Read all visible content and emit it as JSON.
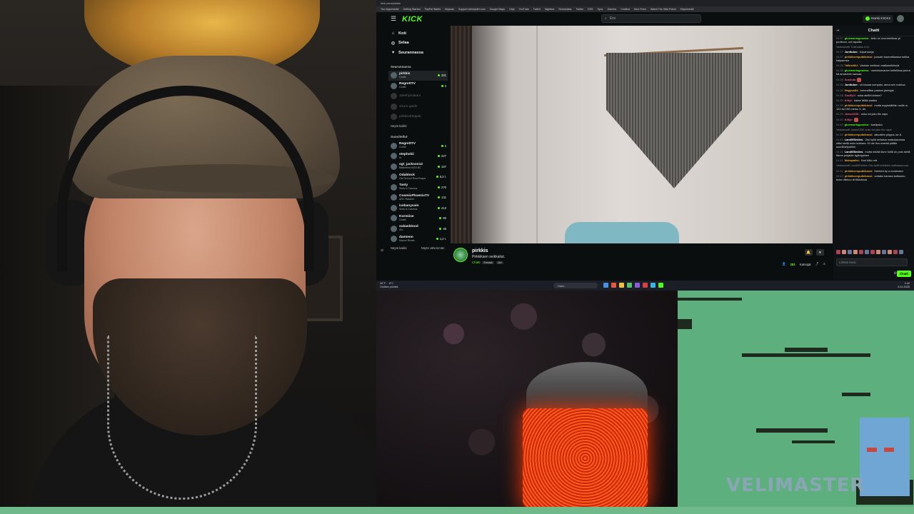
{
  "browser": {
    "tab_title": "kick.com/pirkkis",
    "bookmarks": [
      "Tuo kirjanmerkit",
      "Getting Started",
      "PayPal Wallet",
      "Kirjaudu",
      "Support velimaster.com",
      "Google Maps",
      "Ohje",
      "YouTube",
      "Twitch",
      "Nightbot",
      "Streamlabs",
      "Twitter",
      "DSS",
      "Sync",
      "Gamers",
      "Chatbot",
      "Dino Fixes",
      "Watch The Wild Robot",
      "Kirjanmerkit"
    ]
  },
  "kick": {
    "logo": "KICK",
    "search_placeholder": "Etsi",
    "user_button": "Hanki KICKs"
  },
  "sidebar": {
    "nav": [
      {
        "icon": "⌂",
        "label": "Koti"
      },
      {
        "icon": "◎",
        "label": "Selaa"
      },
      {
        "icon": "♥",
        "label": "Seurannassa"
      }
    ],
    "following_header": "Seurannassa",
    "following": [
      {
        "name": "pirkkis",
        "category": "Chatti",
        "viewers": "281",
        "online": true
      },
      {
        "name": "RegrettTV",
        "category": "Chatti",
        "viewers": "3",
        "online": true
      },
      {
        "name": "Jakehjordaani",
        "category": "",
        "viewers": "",
        "online": false
      },
      {
        "name": "viicen-gaidz",
        "category": "",
        "viewers": "",
        "online": false
      },
      {
        "name": "pirkkis4ttripple",
        "category": "",
        "viewers": "",
        "online": false
      }
    ],
    "show_all": "Näytä kaikki",
    "recommended_header": "Suositellut",
    "recommended": [
      {
        "name": "RegrettTV",
        "category": "Chatti",
        "viewers": "3"
      },
      {
        "name": "stephskii",
        "category": "Irl",
        "viewers": "227"
      },
      {
        "name": "sgt_jackson12",
        "category": "Battlefield 6003 BC",
        "viewers": "167"
      },
      {
        "name": "Odablock",
        "category": "Old School RuneScape",
        "viewers": "8,3 t."
      },
      {
        "name": "Tasty",
        "category": "Slots & Casinos",
        "viewers": "270"
      },
      {
        "name": "CosmicPhoenixTV",
        "category": "ARC Raiders",
        "viewers": "131"
      },
      {
        "name": "icebanyvain",
        "category": "Slots & Casinos",
        "viewers": "413"
      },
      {
        "name": "Kormiise",
        "category": "Chatti",
        "viewers": "80"
      },
      {
        "name": "sukasblood",
        "category": "IRL",
        "viewers": "48"
      },
      {
        "name": "damieon",
        "category": "Marvel Rivals",
        "viewers": "1,2 t."
      }
    ],
    "show_all_2": "Näytä kaikki",
    "show_fewer": "Näytä vähemmän"
  },
  "stream": {
    "channel": "pirkkis",
    "title": "Pirkkiksen seikkailut.",
    "category": "Chatti",
    "tags": [
      "Finnish",
      "18+"
    ],
    "viewers": "281",
    "viewers_label": "Katsojat"
  },
  "chat": {
    "header": "Chatti",
    "messages": [
      {
        "t": "04.37",
        "u": "gluemanisgoodoo:",
        "c": "#53fc18",
        "m": "kello on noormeriikas yli puoltoon, ooi tapuilla"
      },
      {
        "t": "",
        "u": "",
        "c": "",
        "m": "Vastaanotti Tukihaista 4:31",
        "sys": true
      },
      {
        "t": "04.37",
        "u": "Junttuber:",
        "c": "#ffffff",
        "m": "tulpansseja"
      },
      {
        "t": "04.37",
        "u": "pirkkiksenputkikassi:",
        "c": "#f0a63c",
        "m": "joosain kaoruellaassa tulkka kalpaansa"
      },
      {
        "t": "04.38",
        "u": "TalkistikU:",
        "c": "#f0a63c",
        "m": "Vankan verikkan matkaselleissä"
      },
      {
        "t": "04.38",
        "u": "gluemanisgoodoo:",
        "c": "#53fc18",
        "m": "nurmiskavanen keitellissa puhut kä amasimin kansaa"
      },
      {
        "t": "04.38",
        "u": "Susiruta",
        "c": "#e85a7a",
        "m": ""
      },
      {
        "t": "04.38",
        "u": "Junttuber:",
        "c": "#ffffff",
        "m": "sit kiusaa sompasi, anna sen nukkua"
      },
      {
        "t": "04.38",
        "u": "Happus84:",
        "c": "#f0a63c",
        "m": "berrealliksi paskan jauhajat"
      },
      {
        "t": "04.38",
        "u": "GooEyV:",
        "c": "#e85a7a",
        "m": "suka aiellä lubiase?"
      },
      {
        "t": "04.39",
        "u": "Kittyt:",
        "c": "#e85a7a",
        "m": "kaiwe tälää saaika"
      },
      {
        "t": "04.39",
        "u": "pirkkiksenputkikassi:",
        "c": "#f0a63c",
        "m": "mutta myyiskäihän mulle w-124 tai 190 mersu 3- äh."
      },
      {
        "t": "04.39",
        "u": "Jasso0330:",
        "c": "#e85a7a",
        "m": "onko tot joku tilu vaps"
      },
      {
        "t": "04.40",
        "u": "Kittyt:",
        "c": "#e85a7a",
        "m": ""
      },
      {
        "t": "04.40",
        "u": "gluemanisgoodoo:",
        "c": "#53fc18",
        "m": "kaalipsko"
      },
      {
        "t": "",
        "u": "",
        "c": "",
        "m": "Vastaanotti Jasso0330 onko tot joku tilu vaps",
        "sys": true
      },
      {
        "t": "04.40",
        "u": "pirkkiksenputkikassi:",
        "c": "#f0a63c",
        "m": "alkuaiten piippuu se A."
      },
      {
        "t": "04.40",
        "u": "Land0fSmiles:",
        "c": "#ffffff",
        "m": "Oisi kyllä sellaisia matkaasumaa oltisi siellä nuku kulsaan. Ei ole tiva ozavidi päälle suurlähetystöön"
      },
      {
        "t": "04.41",
        "u": "Land0fSmiles:",
        "c": "#ffffff",
        "m": "mutta mikää kivre toillä on pois siellä tänne porjalan kyjimyyteen"
      },
      {
        "t": "04.41",
        "u": "Mekapalist:",
        "c": "#f0a63c",
        "m": "Karl kiiku mä"
      },
      {
        "t": "",
        "u": "",
        "c": "",
        "m": "Vastaanotti Land0fSmiles Oisi kyllä sellaisia matkaasumaa",
        "sys": true
      },
      {
        "t": "04.41",
        "u": "pirkkiksenputkikassi:",
        "c": "#f0a63c",
        "m": "Deleted by a moderator"
      },
      {
        "t": "04.42",
        "u": "pirkkiksenputkikassi:",
        "c": "#f0a63c",
        "m": "oottako tulossa kattoomu tuoto viikkoo tä tiiklukkoa"
      }
    ],
    "input_placeholder": "Lähetä viesti",
    "send_label": "Chatti"
  },
  "taskbar": {
    "weather_temp": "46°F · -6°C",
    "weather_text": "Osittain pilvistä",
    "search": "Haku",
    "time": "4.42",
    "date": "6.11.2025"
  },
  "game": {
    "watermark": "VELIMASTER"
  }
}
